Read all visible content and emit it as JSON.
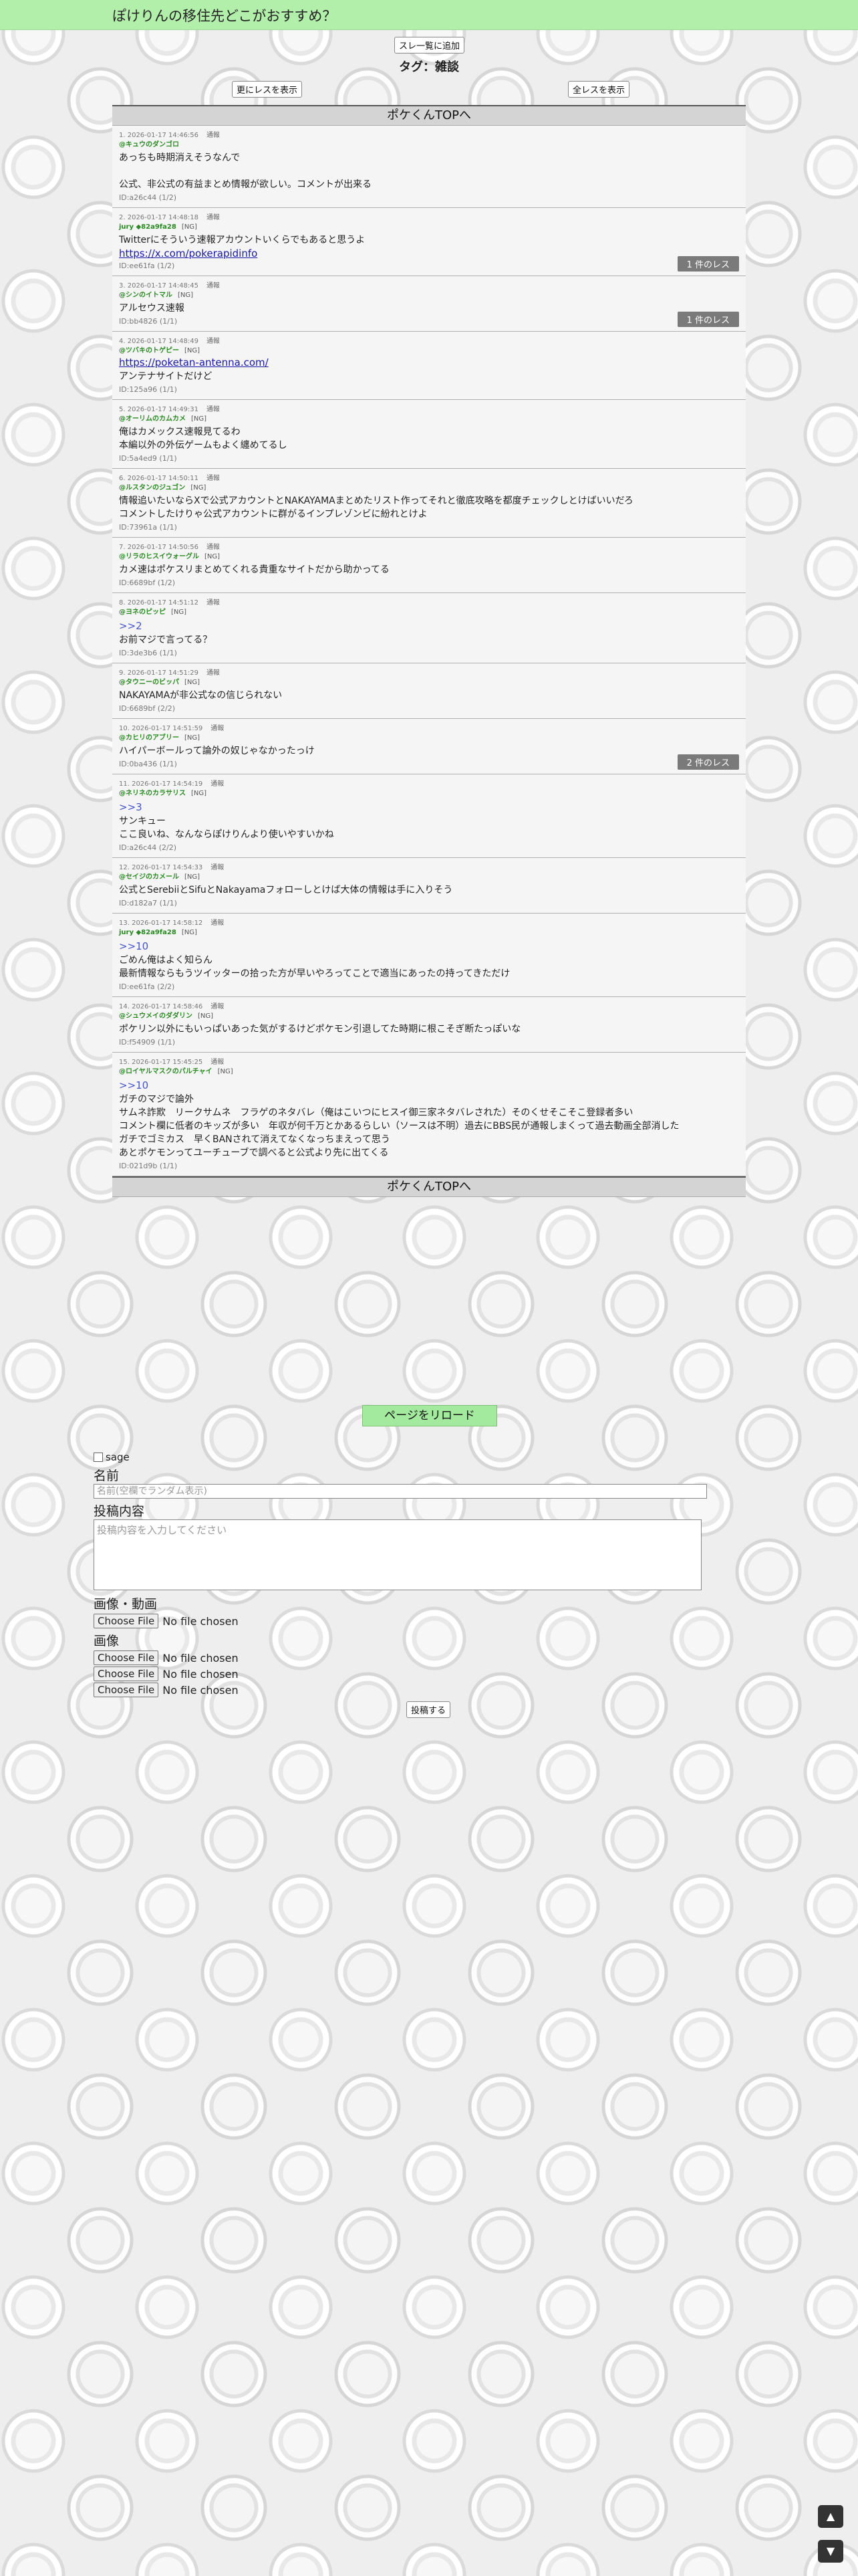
{
  "header": {
    "title": "ぽけりんの移住先どこがおすすめ？"
  },
  "thread_list_button": "スレ一覧に追加",
  "tag_heading": "タグ：雑談",
  "more_replies_button": "更にレスを表示",
  "all_replies_button": "全レスを表示",
  "top_link": "ポケくんTOPへ",
  "report_label": "通報",
  "ng_label": "[NG]",
  "posts": [
    {
      "meta": "1. 2026-01-17 14:46:56",
      "name": "@キュウのダンゴロ",
      "ng": false,
      "anchor": "",
      "body": "あっちも時期消えそうなんで\n\n公式、非公式の有益まとめ情報が欲しい。コメントが出来る",
      "link": "",
      "id": "ID:a26c44 (1/2)",
      "replies": ""
    },
    {
      "meta": "2. 2026-01-17 14:48:18",
      "name": "jury ◆82a9fa28",
      "ng": true,
      "anchor": "",
      "body": "Twitterにそういう速報アカウントいくらでもあると思うよ\n",
      "link": "https://x.com/pokerapidinfo",
      "id": "ID:ee61fa (1/2)",
      "replies": "1 件のレス"
    },
    {
      "meta": "3. 2026-01-17 14:48:45",
      "name": "@シンのイトマル",
      "ng": true,
      "anchor": "",
      "body": "アルセウス速報",
      "link": "",
      "id": "ID:bb4826 (1/1)",
      "replies": "1 件のレス"
    },
    {
      "meta": "4. 2026-01-17 14:48:49",
      "name": "@ツバキのトゲピー",
      "ng": true,
      "anchor": "",
      "body": "",
      "link": "https://poketan-antenna.com/",
      "body2": "アンテナサイトだけど",
      "id": "ID:125a96 (1/1)",
      "replies": ""
    },
    {
      "meta": "5. 2026-01-17 14:49:31",
      "name": "@オーリムのカムカメ",
      "ng": true,
      "anchor": "",
      "body": "俺はカメックス速報見てるわ\n本編以外の外伝ゲームもよく纏めてるし",
      "link": "",
      "id": "ID:5a4ed9 (1/1)",
      "replies": ""
    },
    {
      "meta": "6. 2026-01-17 14:50:11",
      "name": "@ルスタンのジュゴン",
      "ng": true,
      "anchor": "",
      "body": "情報追いたいならXで公式アカウントとNAKAYAMAまとめたリスト作ってそれと徹底攻略を都度チェックしとけばいいだろ\nコメントしたけりゃ公式アカウントに群がるインプレゾンビに紛れとけよ",
      "link": "",
      "id": "ID:73961a (1/1)",
      "replies": ""
    },
    {
      "meta": "7. 2026-01-17 14:50:56",
      "name": "@リラのヒスイウォーグル",
      "ng": true,
      "anchor": "",
      "body": "カメ速はポケスリまとめてくれる貴重なサイトだから助かってる",
      "link": "",
      "id": "ID:6689bf (1/2)",
      "replies": ""
    },
    {
      "meta": "8. 2026-01-17 14:51:12",
      "name": "@ヨネのピッピ",
      "ng": true,
      "anchor": ">>2",
      "body": "お前マジで言ってる？",
      "link": "",
      "id": "ID:3de3b6 (1/1)",
      "replies": ""
    },
    {
      "meta": "9. 2026-01-17 14:51:29",
      "name": "@タウニーのビッパ",
      "ng": true,
      "anchor": "",
      "body": "NAKAYAMAが非公式なの信じられない",
      "link": "",
      "id": "ID:6689bf (2/2)",
      "replies": ""
    },
    {
      "meta": "10. 2026-01-17 14:51:59",
      "name": "@カヒリのアブリー",
      "ng": true,
      "anchor": "",
      "body": "ハイパーボールって論外の奴じゃなかったっけ",
      "link": "",
      "id": "ID:0ba436 (1/1)",
      "replies": "2 件のレス"
    },
    {
      "meta": "11. 2026-01-17 14:54:19",
      "name": "@ネリネのカラサリス",
      "ng": true,
      "anchor": ">>3",
      "body": "サンキュー\nここ良いね、なんならぽけりんより使いやすいかね",
      "link": "",
      "id": "ID:a26c44 (2/2)",
      "replies": ""
    },
    {
      "meta": "12. 2026-01-17 14:54:33",
      "name": "@セイジのカメール",
      "ng": true,
      "anchor": "",
      "body": "公式とSerebiiとSifuとNakayamaフォローしとけば大体の情報は手に入りそう",
      "link": "",
      "id": "ID:d182a7 (1/1)",
      "replies": ""
    },
    {
      "meta": "13. 2026-01-17 14:58:12",
      "name": "jury ◆82a9fa28",
      "ng": true,
      "anchor": ">>10",
      "body": "ごめん俺はよく知らん\n最新情報ならもうツイッターの拾った方が早いやろってことで適当にあったの持ってきただけ",
      "link": "",
      "id": "ID:ee61fa (2/2)",
      "replies": ""
    },
    {
      "meta": "14. 2026-01-17 14:58:46",
      "name": "@シュウメイのダダリン",
      "ng": true,
      "anchor": "",
      "body": "ポケリン以外にもいっぱいあった気がするけどポケモン引退してた時期に根こそぎ断たっぽいな",
      "link": "",
      "id": "ID:f54909 (1/1)",
      "replies": ""
    },
    {
      "meta": "15. 2026-01-17 15:45:25",
      "name": "@ロイヤルマスクのパルチャイ",
      "ng": true,
      "anchor": ">>10",
      "body": "ガチのマジで論外\nサムネ詐欺　リークサムネ　フラゲのネタバレ（俺はこいつにヒスイ御三家ネタバレされた）そのくせそこそこ登録者多い\nコメント欄に低者のキッズが多い　年収が何千万とかあるらしい（ソースは不明）過去にBBS民が通報しまくって過去動画全部消した\nガチでゴミカス　早くBANされて消えてなくなっちまえって思う\nあとポケモンってユーチューブで調べると公式より先に出てくる",
      "link": "",
      "id": "ID:021d9b (1/1)",
      "replies": ""
    }
  ],
  "reload_button": "ページをリロード",
  "form": {
    "sage_label": "sage",
    "name_label": "名前",
    "name_placeholder": "名前(空欄でランダム表示)",
    "content_label": "投稿内容",
    "content_placeholder": "投稿内容を入力してください",
    "media_label": "画像・動画",
    "image_label": "画像",
    "choose_file": "Choose File",
    "no_file": "No file chosen",
    "submit": "投稿する"
  },
  "scroll": {
    "up": "▲",
    "down": "▼"
  },
  "colors": {
    "header_bg": "#b2efaa",
    "name_green": "#2a8a22",
    "anchor_blue": "#4455cc",
    "reload_bg": "#a4ea9e"
  }
}
